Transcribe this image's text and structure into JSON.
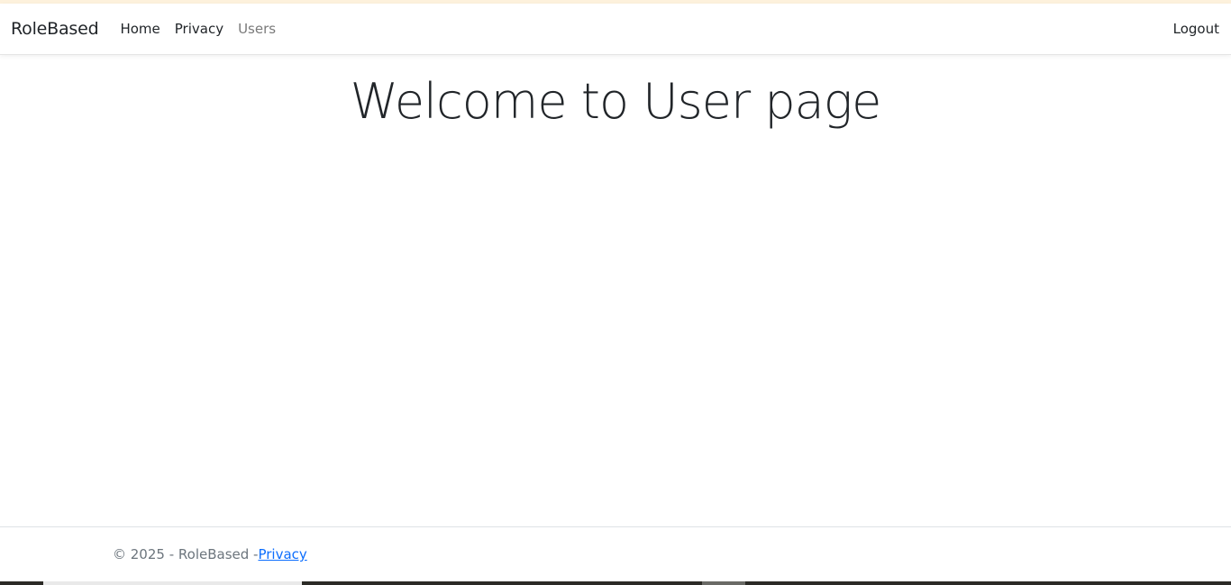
{
  "navbar": {
    "brand": "RoleBased",
    "links": [
      {
        "label": "Home"
      },
      {
        "label": "Privacy"
      },
      {
        "label": "Users"
      }
    ],
    "logout": "Logout"
  },
  "main": {
    "heading": "Welcome to User page"
  },
  "footer": {
    "copyright": "© 2025 - RoleBased - ",
    "privacy_link": "Privacy"
  },
  "colors": {
    "accent_top": "#fdf1dc",
    "link": "#0d6efd",
    "muted_nav": "#7a7a7a"
  }
}
